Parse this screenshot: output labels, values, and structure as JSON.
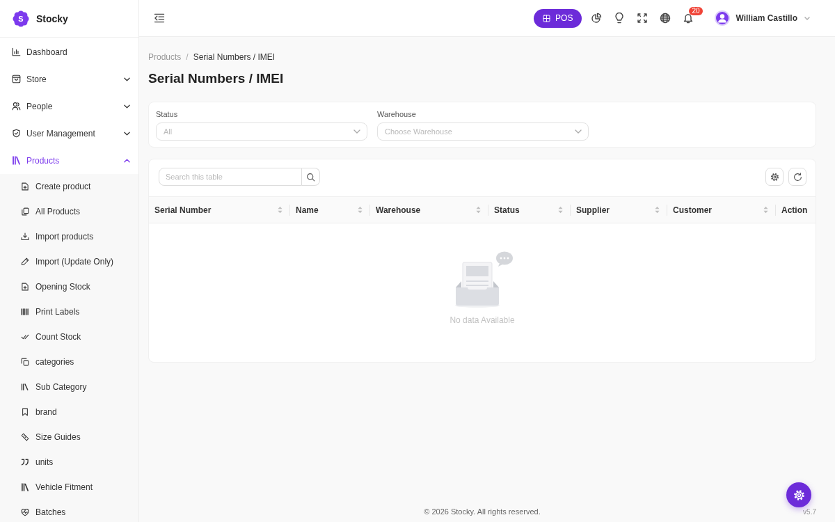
{
  "sidebar": {
    "brand": {
      "logo_letter": "S",
      "name": "Stocky"
    },
    "items": [
      {
        "label": "Dashboard",
        "kind": "link",
        "selected": false
      },
      {
        "label": "Store",
        "kind": "group",
        "selected": false,
        "expanded": false
      },
      {
        "label": "People",
        "kind": "group",
        "selected": false,
        "expanded": false
      },
      {
        "label": "User Management",
        "kind": "group",
        "selected": false,
        "expanded": false
      },
      {
        "label": "Products",
        "kind": "group",
        "selected": true,
        "expanded": true,
        "children": [
          {
            "label": "Create product",
            "selected": false
          },
          {
            "label": "All Products",
            "selected": false
          },
          {
            "label": "Import products",
            "selected": false
          },
          {
            "label": "Import (Update Only)",
            "selected": false
          },
          {
            "label": "Opening Stock",
            "selected": false
          },
          {
            "label": "Print Labels",
            "selected": false
          },
          {
            "label": "Count Stock",
            "selected": false
          },
          {
            "label": "categories",
            "selected": false
          },
          {
            "label": "Sub Category",
            "selected": false
          },
          {
            "label": "brand",
            "selected": false
          },
          {
            "label": "Size Guides",
            "selected": false
          },
          {
            "label": "units",
            "selected": false
          },
          {
            "label": "Vehicle Fitment",
            "selected": false
          },
          {
            "label": "Batches",
            "selected": false
          }
        ]
      }
    ]
  },
  "topbar": {
    "pos_button": "POS",
    "notification_count": "20",
    "user_name": "William Castillo"
  },
  "breadcrumb": {
    "items": [
      "Products",
      "Serial Numbers / IMEI"
    ],
    "separator": "/"
  },
  "page_title": "Serial Numbers / IMEI",
  "filters": [
    {
      "label": "Status",
      "placeholder": "All"
    },
    {
      "label": "Warehouse",
      "placeholder": "Choose Warehouse"
    }
  ],
  "table": {
    "search": {
      "placeholder": "Search this table"
    },
    "columns": [
      {
        "label": "Serial Number",
        "sortable": true
      },
      {
        "label": "Name",
        "sortable": true
      },
      {
        "label": "Warehouse",
        "sortable": true
      },
      {
        "label": "Status",
        "sortable": true
      },
      {
        "label": "Supplier",
        "sortable": true
      },
      {
        "label": "Customer",
        "sortable": true
      },
      {
        "label": "Action",
        "sortable": false
      }
    ],
    "empty_message": "No data Available"
  },
  "footer": {
    "copyright": "© 2026 Stocky. All rights reserved.",
    "version": "v5.7"
  }
}
